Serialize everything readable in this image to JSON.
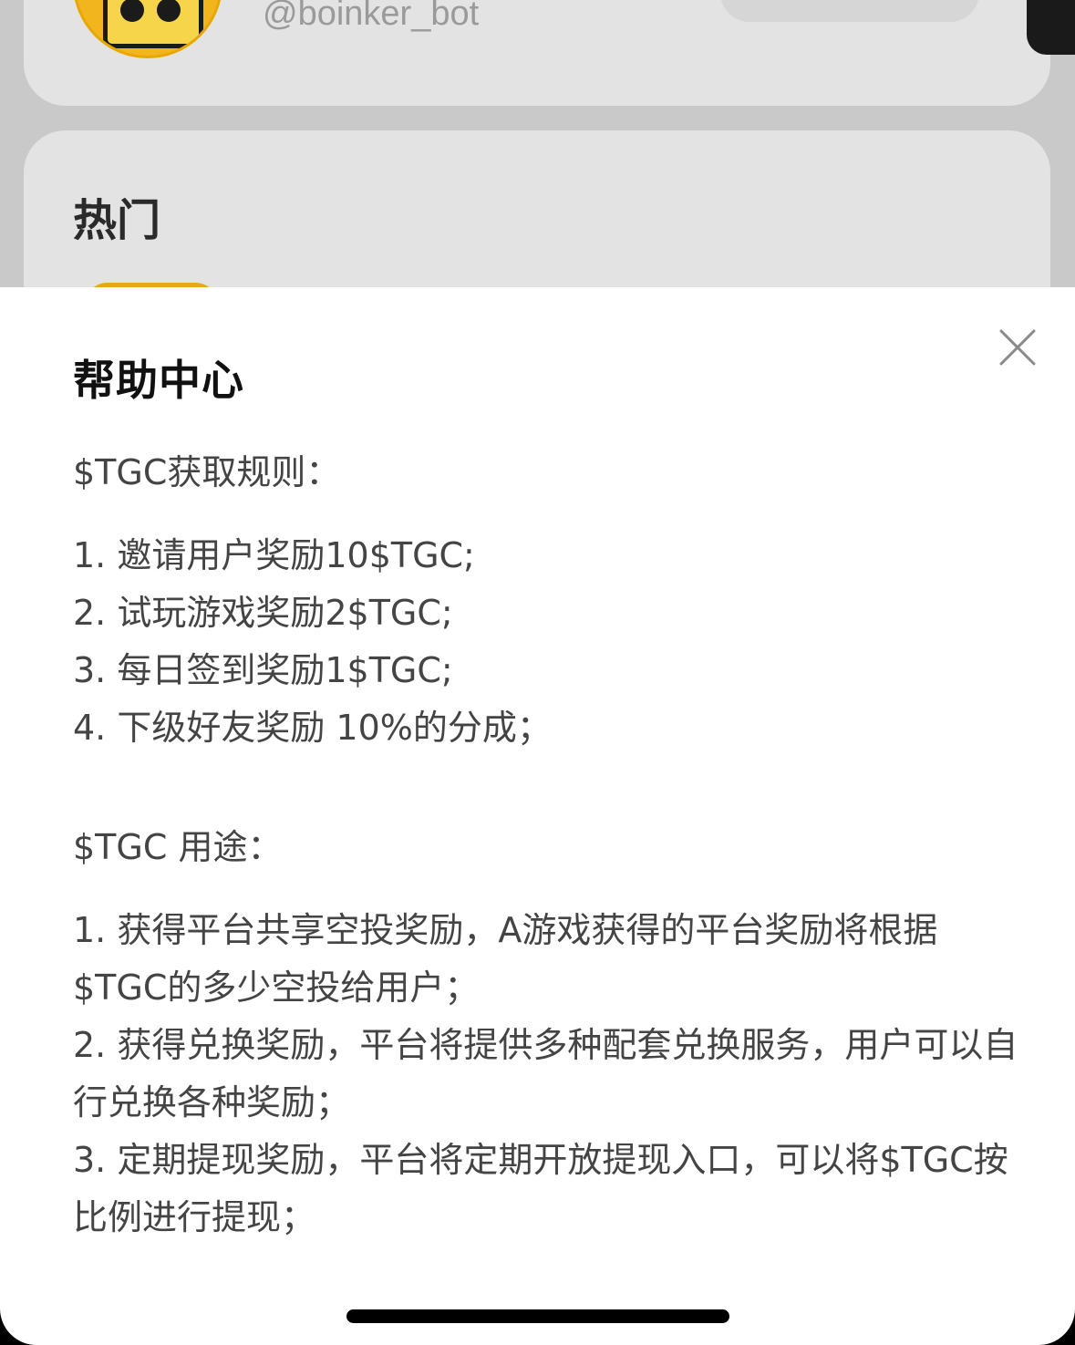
{
  "background": {
    "profile": {
      "handle": "@boinker_bot"
    },
    "hot_section": {
      "title": "热门"
    }
  },
  "help_sheet": {
    "title": "帮助中心",
    "close_icon": "close-icon",
    "acquire_heading": "$TGC获取规则：",
    "acquire_rules": [
      "1. 邀请用户奖励10$TGC;",
      "2. 试玩游戏奖励2$TGC;",
      "3. 每日签到奖励1$TGC;",
      "4. 下级好友奖励 10%的分成；"
    ],
    "uses_heading": "$TGC 用途：",
    "uses": [
      "1. 获得平台共享空投奖励，A游戏获得的平台奖励将根据$TGC的多少空投给用户；",
      "2. 获得兑换奖励，平台将提供多种配套兑换服务，用户可以自行兑换各种奖励；",
      "3. 定期提现奖励，平台将定期开放提现入口，可以将$TGC按比例进行提现；"
    ]
  },
  "colors": {
    "sheet_bg": "#ffffff",
    "overlay_bg": "#c9c9c9",
    "accent": "#f2b51d",
    "text": "#444444",
    "title": "#111111"
  }
}
